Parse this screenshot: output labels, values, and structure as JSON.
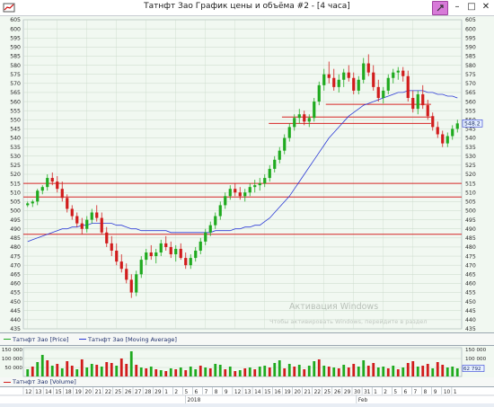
{
  "window": {
    "title": "Татнфт Зао График цены и объёма #2 - [4 часа]",
    "controls": {
      "minimize": "–",
      "maximize": "□",
      "close": "✕"
    }
  },
  "chart_data": {
    "type": "candlestick",
    "title": "",
    "y_axis": {
      "min": 435,
      "max": 605,
      "ticks": [
        435,
        440,
        445,
        450,
        455,
        460,
        465,
        470,
        475,
        480,
        485,
        490,
        495,
        500,
        505,
        510,
        515,
        520,
        525,
        530,
        535,
        540,
        545,
        550,
        555,
        560,
        565,
        570,
        575,
        580,
        585,
        590,
        595,
        600,
        605
      ]
    },
    "last_price_label": "548.2",
    "support_lines": [
      {
        "price": 515,
        "x_from": 0.0,
        "x_to": 1.0
      },
      {
        "price": 507.5,
        "x_from": 0.0,
        "x_to": 1.0
      },
      {
        "price": 487,
        "x_from": 0.0,
        "x_to": 1.0
      },
      {
        "price": 558.5,
        "x_from": 0.69,
        "x_to": 0.93
      },
      {
        "price": 551.5,
        "x_from": 0.59,
        "x_to": 0.93
      },
      {
        "price": 548,
        "x_from": 0.56,
        "x_to": 0.93
      }
    ],
    "price_series": {
      "name": "Татнфт Зао [Price]",
      "candles": [
        [
          503,
          505,
          502,
          504
        ],
        [
          504,
          506,
          502,
          505
        ],
        [
          505,
          512,
          503,
          511
        ],
        [
          511,
          514,
          509,
          513
        ],
        [
          513,
          520,
          511,
          518
        ],
        [
          518,
          521,
          514,
          516
        ],
        [
          516,
          519,
          510,
          512
        ],
        [
          512,
          516,
          505,
          507
        ],
        [
          507,
          509,
          499,
          501
        ],
        [
          501,
          503,
          495,
          497
        ],
        [
          497,
          499,
          491,
          493
        ],
        [
          493,
          496,
          487,
          490
        ],
        [
          490,
          497,
          488,
          495
        ],
        [
          495,
          501,
          493,
          499
        ],
        [
          499,
          503,
          494,
          496
        ],
        [
          496,
          499,
          487,
          488
        ],
        [
          488,
          491,
          480,
          482
        ],
        [
          482,
          486,
          475,
          478
        ],
        [
          478,
          482,
          470,
          472
        ],
        [
          472,
          476,
          466,
          468
        ],
        [
          468,
          471,
          460,
          462
        ],
        [
          462,
          465,
          452,
          455
        ],
        [
          455,
          467,
          453,
          465
        ],
        [
          465,
          475,
          463,
          473
        ],
        [
          473,
          479,
          470,
          477
        ],
        [
          477,
          481,
          473,
          475
        ],
        [
          475,
          479,
          471,
          477
        ],
        [
          477,
          484,
          475,
          482
        ],
        [
          482,
          486,
          478,
          480
        ],
        [
          480,
          483,
          474,
          476
        ],
        [
          476,
          481,
          472,
          479
        ],
        [
          479,
          482,
          473,
          474
        ],
        [
          474,
          477,
          468,
          470
        ],
        [
          470,
          476,
          468,
          474
        ],
        [
          474,
          480,
          472,
          478
        ],
        [
          478,
          485,
          476,
          483
        ],
        [
          483,
          490,
          481,
          488
        ],
        [
          488,
          494,
          486,
          492
        ],
        [
          492,
          499,
          490,
          497
        ],
        [
          497,
          505,
          495,
          503
        ],
        [
          503,
          510,
          501,
          508
        ],
        [
          508,
          514,
          506,
          512
        ],
        [
          512,
          515,
          508,
          510
        ],
        [
          510,
          513,
          506,
          508
        ],
        [
          508,
          512,
          505,
          510
        ],
        [
          510,
          515,
          508,
          513
        ],
        [
          513,
          517,
          510,
          514
        ],
        [
          514,
          518,
          511,
          515
        ],
        [
          515,
          520,
          513,
          518
        ],
        [
          518,
          525,
          516,
          523
        ],
        [
          523,
          530,
          521,
          528
        ],
        [
          528,
          535,
          526,
          533
        ],
        [
          533,
          542,
          531,
          540
        ],
        [
          540,
          548,
          538,
          546
        ],
        [
          546,
          553,
          544,
          551
        ],
        [
          551,
          556,
          548,
          553
        ],
        [
          553,
          555,
          547,
          549
        ],
        [
          549,
          553,
          546,
          551
        ],
        [
          551,
          562,
          549,
          560
        ],
        [
          560,
          571,
          558,
          569
        ],
        [
          569,
          578,
          566,
          575
        ],
        [
          575,
          582,
          570,
          573
        ],
        [
          573,
          578,
          566,
          568
        ],
        [
          568,
          575,
          565,
          572
        ],
        [
          572,
          578,
          568,
          576
        ],
        [
          576,
          580,
          571,
          573
        ],
        [
          573,
          576,
          564,
          566
        ],
        [
          566,
          574,
          564,
          572
        ],
        [
          572,
          584,
          570,
          581
        ],
        [
          581,
          586,
          574,
          576
        ],
        [
          576,
          580,
          566,
          568
        ],
        [
          568,
          572,
          560,
          562
        ],
        [
          562,
          568,
          559,
          566
        ],
        [
          566,
          575,
          564,
          573
        ],
        [
          573,
          578,
          570,
          576
        ],
        [
          576,
          579,
          572,
          577
        ],
        [
          577,
          579,
          571,
          574
        ],
        [
          574,
          577,
          560,
          562
        ],
        [
          562,
          566,
          554,
          556
        ],
        [
          556,
          566,
          553,
          564
        ],
        [
          564,
          569,
          556,
          558
        ],
        [
          558,
          561,
          550,
          552
        ],
        [
          552,
          554,
          544,
          546
        ],
        [
          546,
          549,
          540,
          542
        ],
        [
          542,
          544,
          535,
          537
        ],
        [
          537,
          543,
          535,
          541
        ],
        [
          541,
          547,
          539,
          545
        ],
        [
          545,
          550,
          543,
          548
        ]
      ]
    },
    "moving_average": {
      "name": "Татнфт Зао [Moving Average]",
      "values": [
        483,
        484,
        485,
        486,
        487,
        488,
        489,
        490,
        490,
        491,
        491,
        492,
        492,
        493,
        493,
        493,
        493,
        493,
        492,
        492,
        491,
        490,
        490,
        489,
        489,
        489,
        489,
        489,
        489,
        488,
        488,
        488,
        488,
        488,
        488,
        488,
        488,
        488,
        489,
        489,
        489,
        489,
        490,
        490,
        491,
        491,
        492,
        492,
        494,
        496,
        499,
        502,
        505,
        508,
        512,
        516,
        520,
        524,
        528,
        532,
        536,
        540,
        543,
        546,
        549,
        552,
        554,
        556,
        558,
        559,
        560,
        561,
        562,
        563,
        564,
        565,
        565,
        566,
        566,
        566,
        566,
        565,
        565,
        564,
        564,
        563,
        563,
        562
      ]
    },
    "volume": {
      "name": "Татнфт Зао [Volume]",
      "y_ticks": [
        "150 000",
        "100 000",
        "50 000"
      ],
      "last_label": "62 792",
      "bars": [
        [
          1,
          40
        ],
        [
          0,
          55
        ],
        [
          1,
          80
        ],
        [
          1,
          120
        ],
        [
          0,
          90
        ],
        [
          1,
          60
        ],
        [
          0,
          70
        ],
        [
          1,
          45
        ],
        [
          0,
          85
        ],
        [
          0,
          60
        ],
        [
          1,
          40
        ],
        [
          0,
          95
        ],
        [
          1,
          50
        ],
        [
          1,
          70
        ],
        [
          0,
          65
        ],
        [
          1,
          55
        ],
        [
          0,
          80
        ],
        [
          0,
          75
        ],
        [
          1,
          60
        ],
        [
          0,
          100
        ],
        [
          0,
          70
        ],
        [
          1,
          140
        ],
        [
          0,
          65
        ],
        [
          1,
          50
        ],
        [
          0,
          45
        ],
        [
          1,
          55
        ],
        [
          0,
          40
        ],
        [
          1,
          35
        ],
        [
          0,
          30
        ],
        [
          1,
          45
        ],
        [
          0,
          40
        ],
        [
          1,
          50
        ],
        [
          0,
          35
        ],
        [
          1,
          55
        ],
        [
          1,
          40
        ],
        [
          0,
          60
        ],
        [
          1,
          50
        ],
        [
          0,
          45
        ],
        [
          1,
          70
        ],
        [
          1,
          65
        ],
        [
          0,
          40
        ],
        [
          1,
          55
        ],
        [
          0,
          30
        ],
        [
          1,
          35
        ],
        [
          0,
          45
        ],
        [
          1,
          50
        ],
        [
          0,
          40
        ],
        [
          1,
          55
        ],
        [
          1,
          60
        ],
        [
          0,
          50
        ],
        [
          1,
          75
        ],
        [
          1,
          90
        ],
        [
          0,
          45
        ],
        [
          1,
          70
        ],
        [
          0,
          55
        ],
        [
          1,
          65
        ],
        [
          0,
          40
        ],
        [
          1,
          60
        ],
        [
          1,
          85
        ],
        [
          0,
          95
        ],
        [
          1,
          60
        ],
        [
          0,
          55
        ],
        [
          1,
          50
        ],
        [
          0,
          45
        ],
        [
          1,
          65
        ],
        [
          0,
          50
        ],
        [
          0,
          70
        ],
        [
          1,
          55
        ],
        [
          1,
          90
        ],
        [
          0,
          60
        ],
        [
          0,
          75
        ],
        [
          1,
          50
        ],
        [
          1,
          55
        ],
        [
          0,
          45
        ],
        [
          1,
          60
        ],
        [
          0,
          40
        ],
        [
          1,
          50
        ],
        [
          0,
          75
        ],
        [
          0,
          85
        ],
        [
          1,
          55
        ],
        [
          0,
          60
        ],
        [
          0,
          70
        ],
        [
          1,
          45
        ],
        [
          0,
          80
        ],
        [
          0,
          65
        ],
        [
          1,
          50
        ],
        [
          1,
          55
        ],
        [
          1,
          45
        ]
      ]
    },
    "x_axis": {
      "day_labels": [
        "12",
        "13",
        "14",
        "15",
        "18",
        "19",
        "20",
        "21",
        "22",
        "25",
        "26",
        "27",
        "28",
        "29",
        "1",
        "2",
        "5",
        "6",
        "7",
        "8",
        "9",
        "12",
        "13",
        "14",
        "15",
        "16",
        "19",
        "20",
        "21",
        "22",
        "25",
        "26",
        "29",
        "30",
        "31",
        "1",
        "2",
        "5",
        "6",
        "7",
        "8",
        "9",
        "10",
        "1"
      ],
      "month_labels": [
        {
          "text": "2018",
          "at": 0.37
        },
        {
          "text": "Feb",
          "at": 0.76
        }
      ]
    }
  },
  "colors": {
    "bull": "#1faa1f",
    "bear": "#d11c1c",
    "ma": "#2b39d6",
    "support": "#d62424",
    "grid": "#c9d9c9"
  },
  "watermark": "Активация Windows",
  "watermark_sub": "Чтобы активировать Windows, перейдите в раздел"
}
